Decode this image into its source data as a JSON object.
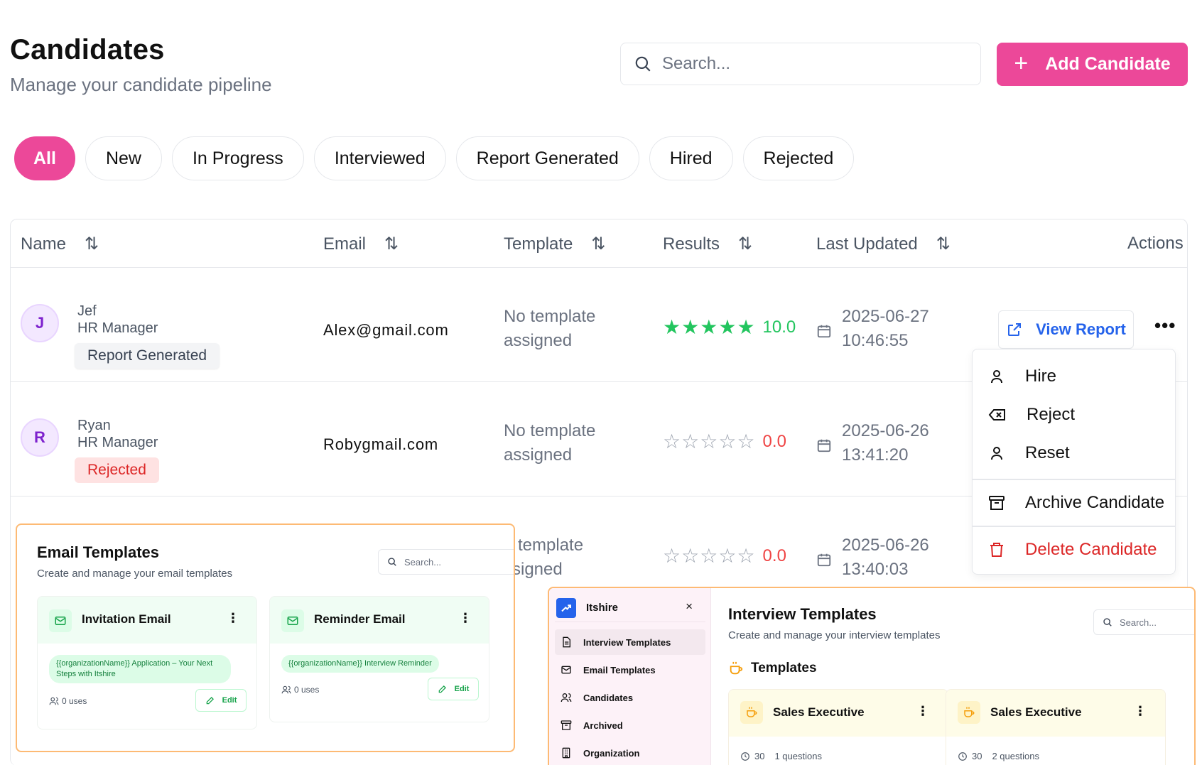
{
  "header": {
    "title": "Candidates",
    "subtitle": "Manage your candidate pipeline",
    "search_placeholder": "Search...",
    "add_label": "Add Candidate"
  },
  "filters": [
    "All",
    "New",
    "In Progress",
    "Interviewed",
    "Report Generated",
    "Hired",
    "Rejected"
  ],
  "active_filter": "All",
  "table": {
    "columns": [
      "Name",
      "Email",
      "Template",
      "Results",
      "Last Updated",
      "Actions"
    ],
    "rows": [
      {
        "initial": "J",
        "name": "Jef",
        "role": "HR Manager",
        "status": "Report Generated",
        "email": "Alex@gmail.com",
        "template_line1": "No template",
        "template_line2": "assigned",
        "rating": 5,
        "score": "10.0",
        "date": "2025-06-27",
        "time": "10:46:55",
        "action_label": "View Report"
      },
      {
        "initial": "R",
        "name": "Ryan",
        "role": "HR Manager",
        "status": "Rejected",
        "email": "Robygmail.com",
        "template_line1": "No template",
        "template_line2": "assigned",
        "rating": 0,
        "score": "0.0",
        "date": "2025-06-26",
        "time": "13:41:20"
      },
      {
        "template_line1": "o template",
        "template_line2": "ssigned",
        "rating": 0,
        "score": "0.0",
        "date": "2025-06-26",
        "time": "13:40:03"
      }
    ]
  },
  "menu": {
    "items": [
      "Hire",
      "Reject",
      "Reset",
      "Archive Candidate",
      "Delete Candidate"
    ]
  },
  "email_templates": {
    "title": "Email Templates",
    "subtitle": "Create and manage your email templates",
    "search_placeholder": "Search...",
    "cards": [
      {
        "name": "Invitation Email",
        "tag": "{{organizationName}} Application – Your Next Steps with Itshire",
        "uses": "0 uses",
        "edit": "Edit"
      },
      {
        "name": "Reminder Email",
        "tag": "{{organizationName}} Interview Reminder",
        "uses": "0 uses",
        "edit": "Edit"
      }
    ]
  },
  "interview_templates": {
    "brand": "Itshire",
    "close": "×",
    "nav": [
      "Interview Templates",
      "Email Templates",
      "Candidates",
      "Archived",
      "Organization"
    ],
    "title": "Interview Templates",
    "subtitle": "Create and manage your interview templates",
    "search_placeholder": "Search...",
    "section": "Templates",
    "cards": [
      {
        "name": "Sales Executive",
        "duration": "30",
        "questions": "1 questions"
      },
      {
        "name": "Sales Executive",
        "duration": "30",
        "questions": "2 questions"
      }
    ]
  },
  "colors": {
    "accent": "#ec4899",
    "link": "#2563eb",
    "success": "#22c55e",
    "danger": "#dc2626",
    "inset_border": "#fdba74"
  }
}
